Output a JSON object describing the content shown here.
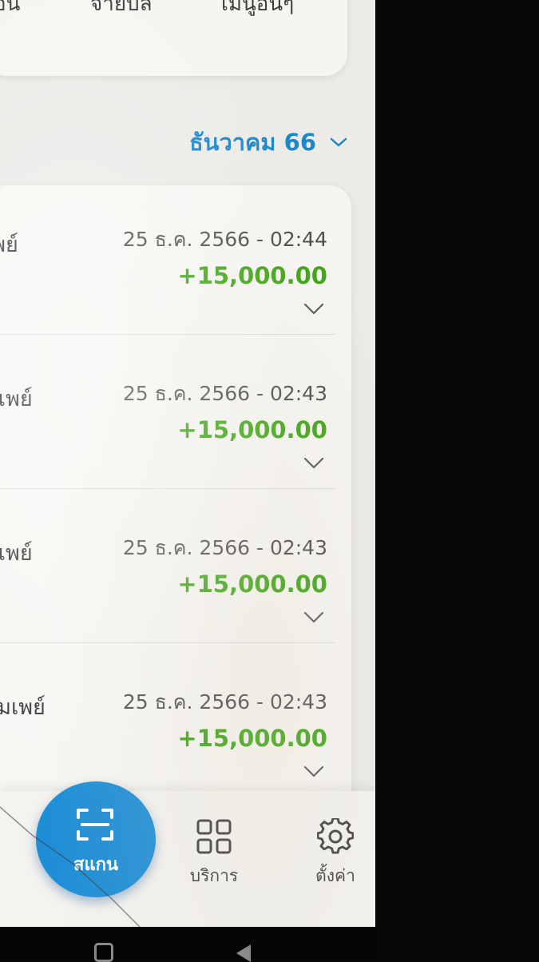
{
  "top_menu": {
    "items": [
      {
        "label": "อน"
      },
      {
        "label": "จ่ายบิล"
      },
      {
        "label": "เมนูอื่นๆ"
      }
    ]
  },
  "month_selector": {
    "label": "ธันวาคม 66",
    "icon": "chevron-down-icon"
  },
  "transactions": [
    {
      "name": "เพย์",
      "date": "25 ธ.ค. 2566 - 02:44",
      "amount": "+15,000.00"
    },
    {
      "name": "มเพย์",
      "date": "25 ธ.ค. 2566 - 02:43",
      "amount": "+15,000.00"
    },
    {
      "name": "มเพย์",
      "date": "25 ธ.ค. 2566 - 02:43",
      "amount": "+15,000.00"
    },
    {
      "name": "อมเพย์",
      "date": "25 ธ.ค. 2566 - 02:43",
      "amount": "+15,000.00"
    }
  ],
  "bottom_nav": {
    "scan_label": "สแกน",
    "services_label": "บริการ",
    "settings_label": "ตั้งค่า"
  },
  "colors": {
    "accent": "#1a87c9",
    "scan_button": "#1e8ed6",
    "amount_positive": "#3aa312"
  }
}
